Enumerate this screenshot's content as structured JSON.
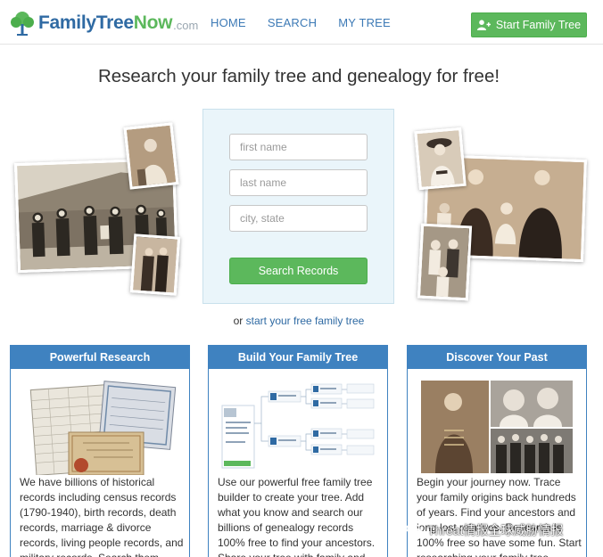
{
  "header": {
    "logo": {
      "family": "FamilyTree",
      "now": "Now",
      "com": ".com"
    },
    "nav": [
      {
        "label": "HOME"
      },
      {
        "label": "SEARCH"
      },
      {
        "label": "MY TREE"
      }
    ],
    "start_button": {
      "label": "Start Family Tree",
      "icon": "add-user-icon"
    }
  },
  "hero": {
    "title": "Research your family tree and genealogy for free!",
    "search": {
      "first_name": {
        "placeholder": "first name",
        "value": ""
      },
      "last_name": {
        "placeholder": "last name",
        "value": ""
      },
      "location": {
        "placeholder": "city, state",
        "value": ""
      },
      "button_label": "Search Records"
    },
    "alt_prefix": "or",
    "alt_link": "start your free family tree"
  },
  "cards": [
    {
      "title": "Powerful Research",
      "text": "We have billions of historical records including census records (1790-1940), birth records, death records, marriage & divorce records, living people records, and military records. Search them"
    },
    {
      "title": "Build Your Family Tree",
      "text": "Use our powerful free family tree builder to create your tree. Add what you know and search our billions of genealogy records 100% free to find your ancestors. Share your tree with family and"
    },
    {
      "title": "Discover Your Past",
      "text": "Begin your journey now. Trace your family origins back hundreds of years. Find your ancestors and long lost relatives. Research is 100% free so have some fun. Start researching your family tree"
    }
  ],
  "watermark": {
    "text": "Threat情报全球威胁情报"
  },
  "colors": {
    "brand_blue": "#2f6aa3",
    "brand_green": "#5cb85c",
    "card_header": "#3f82c0",
    "panel_bg": "#eaf5fa"
  }
}
